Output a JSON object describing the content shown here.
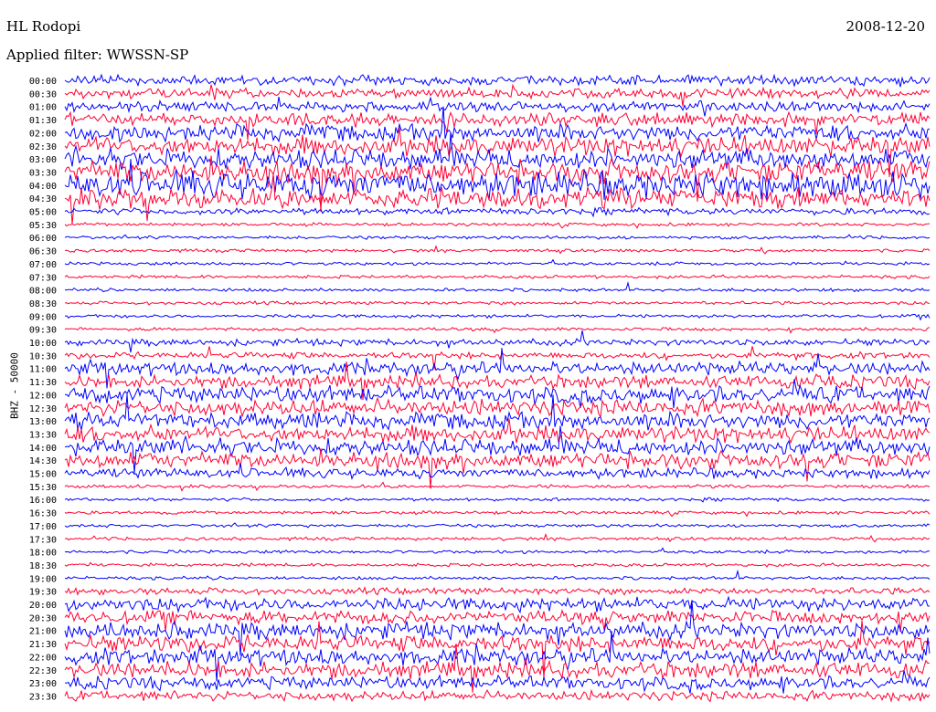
{
  "header": {
    "station": "HL Rodopi",
    "date": "2008-12-20",
    "filter": "Applied filter: WWSSN-SP"
  },
  "colors": {
    "blue": "#0000ff",
    "red": "#ff0033"
  },
  "chart_data": {
    "type": "line",
    "title": "HL Rodopi",
    "ylabel": "BHZ - 50000",
    "ticks": [
      "00:00",
      "00:30",
      "01:00",
      "01:30",
      "02:00",
      "02:30",
      "03:00",
      "03:30",
      "04:00",
      "04:30",
      "05:00",
      "05:30",
      "06:00",
      "06:30",
      "07:00",
      "07:30",
      "08:00",
      "08:30",
      "09:00",
      "09:30",
      "10:00",
      "10:30",
      "11:00",
      "11:30",
      "12:00",
      "12:30",
      "13:00",
      "13:30",
      "14:00",
      "14:30",
      "15:00",
      "15:30",
      "16:00",
      "16:30",
      "17:00",
      "17:30",
      "18:00",
      "18:30",
      "19:00",
      "19:30",
      "20:00",
      "20:30",
      "21:00",
      "21:30",
      "22:00",
      "22:30",
      "23:00",
      "23:30"
    ],
    "trace_colors": [
      "blue",
      "red"
    ],
    "trace_amplitude_level": [
      3,
      3,
      3,
      4,
      5,
      6,
      6,
      7,
      8,
      6,
      2,
      1,
      1,
      1,
      1,
      1,
      1,
      1,
      1,
      1,
      2,
      2,
      4,
      4,
      5,
      5,
      5,
      5,
      5,
      5,
      3,
      1,
      1,
      1,
      1,
      1,
      1,
      1,
      1,
      2,
      4,
      4,
      5,
      5,
      5,
      5,
      4,
      3
    ]
  }
}
